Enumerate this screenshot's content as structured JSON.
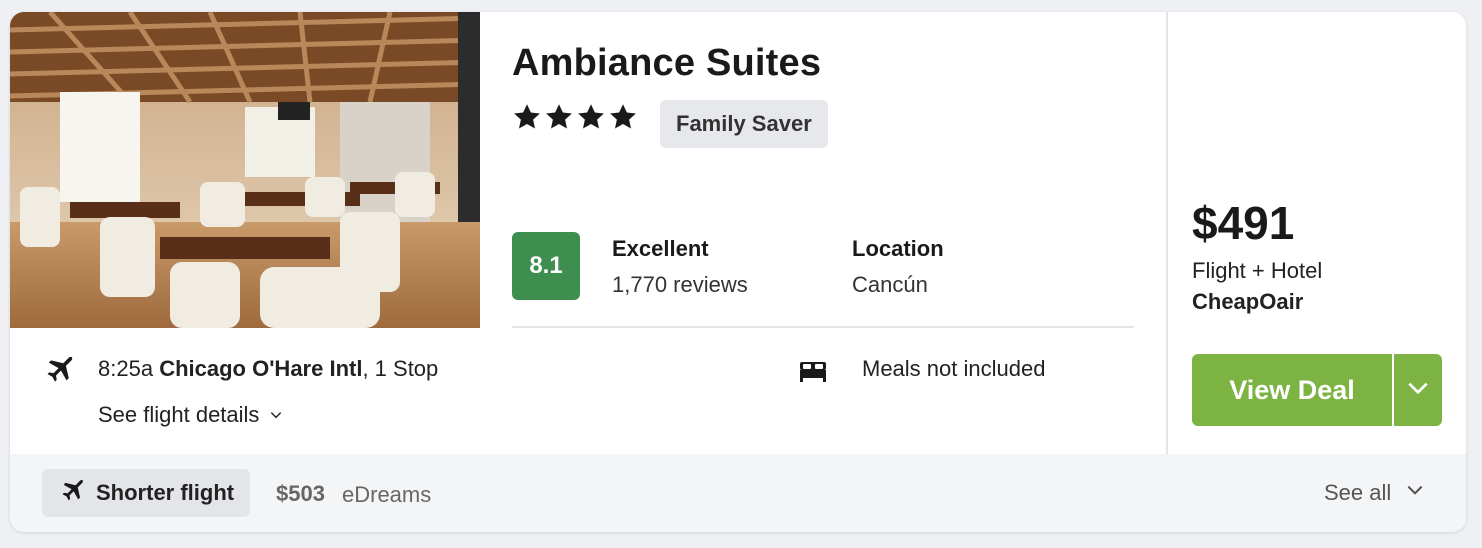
{
  "hotel": {
    "name": "Ambiance Suites",
    "star_count": 4,
    "badge": "Family Saver",
    "score": "8.1",
    "rating_word": "Excellent",
    "reviews": "1,770 reviews",
    "location_label": "Location",
    "location_value": "Cancún"
  },
  "flight": {
    "time": "8:25a",
    "airport": "Chicago O'Hare Intl",
    "stops": ", 1 Stop",
    "details_link": "See flight details"
  },
  "meals": "Meals not included",
  "pricing": {
    "price": "$491",
    "package": "Flight + Hotel",
    "provider": "CheapOair",
    "button_label": "View Deal",
    "accent_color": "#7cb342"
  },
  "footer": {
    "tag_label": "Shorter flight",
    "alt_price": "$503",
    "alt_provider": "eDreams",
    "see_all": "See all"
  },
  "icons": [
    "plane-icon",
    "chevron-down-icon",
    "bed-icon",
    "star-icon"
  ],
  "colors": {
    "score_bg": "#3e8e4f",
    "cta_green": "#7cb342"
  }
}
